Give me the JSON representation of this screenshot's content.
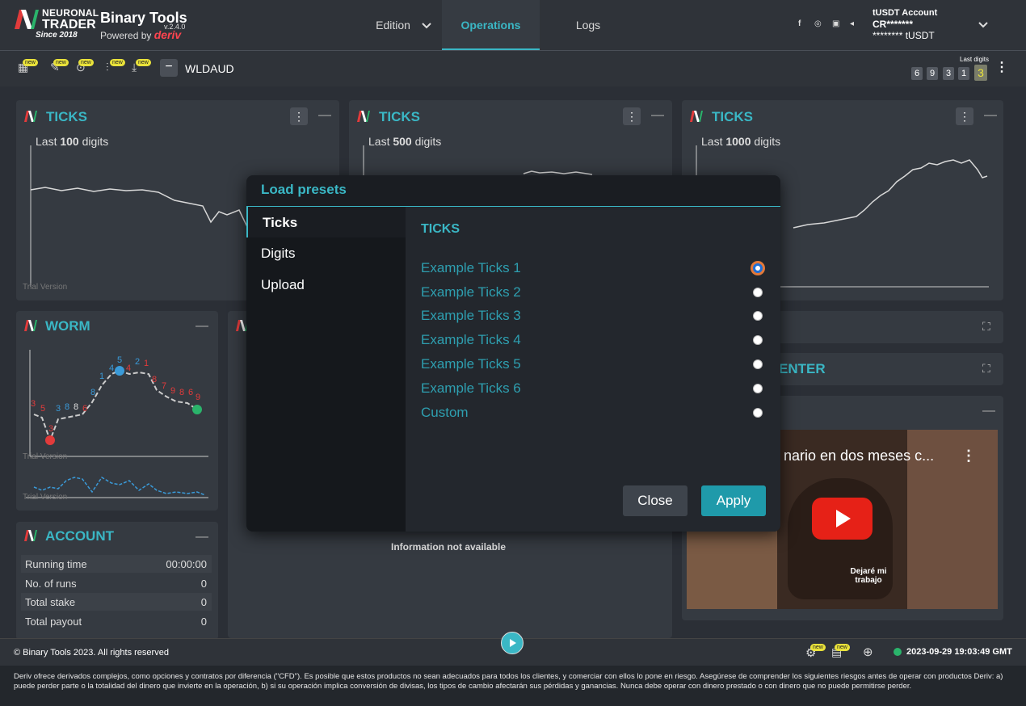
{
  "brand": {
    "line1": "NEURONAL",
    "line2": "TRADER",
    "since": "Since 2018",
    "title": "Binary Tools",
    "version": "v.2.4.0",
    "powered": "Powered by",
    "deriv": "deriv"
  },
  "nav": {
    "edition": "Edition",
    "operations": "Operations",
    "logs": "Logs"
  },
  "account": {
    "name": "tUSDT Account",
    "id": "CR*******",
    "balance": "******** tUSDT"
  },
  "toolbar": {
    "symbol": "WLDAUD",
    "new_badge": "new",
    "last_digits_label": "Last digits",
    "last_digits": [
      "6",
      "9",
      "3",
      "1",
      "3"
    ]
  },
  "panels": {
    "ticks1": {
      "title": "TICKS",
      "label_pre": "Last",
      "count": "100",
      "label_post": "digits"
    },
    "ticks2": {
      "title": "TICKS",
      "label_pre": "Last",
      "count": "500",
      "label_post": "digits"
    },
    "ticks3": {
      "title": "TICKS",
      "label_pre": "Last",
      "count": "1000",
      "label_post": "digits"
    },
    "worm": {
      "title": "WORM",
      "digits_top": [
        "3",
        "5",
        "3",
        "3",
        "8",
        "8",
        "6",
        "8",
        "1",
        "4",
        "5",
        "4",
        "2",
        "1",
        "8",
        "7",
        "9",
        "8",
        "6",
        "9"
      ],
      "digits_bottom": [
        "3",
        "5",
        "3",
        "3",
        "8",
        "8",
        "6",
        "8",
        "1",
        "4",
        "5",
        "4",
        "2",
        "1",
        "8",
        "7",
        "9",
        "8",
        "6",
        "9"
      ]
    },
    "account": {
      "title": "ACCOUNT",
      "rows": [
        {
          "k": "Running time",
          "v": "00:00:00"
        },
        {
          "k": "No. of runs",
          "v": "0"
        },
        {
          "k": "Total stake",
          "v": "0"
        },
        {
          "k": "Total payout",
          "v": "0"
        }
      ]
    },
    "center": {
      "title_fragment": "ENTER",
      "info": "Information not available"
    },
    "video": {
      "title": "nario en dos meses c...",
      "caption1": "Dejaré mi",
      "caption2": "trabajo"
    },
    "trial": "Trial Version"
  },
  "modal": {
    "title": "Load presets",
    "tabs": [
      "Ticks",
      "Digits",
      "Upload"
    ],
    "section": "TICKS",
    "options": [
      "Example Ticks 1",
      "Example Ticks 2",
      "Example Ticks 3",
      "Example Ticks 4",
      "Example Ticks 5",
      "Example Ticks 6",
      "Custom"
    ],
    "selected": 0,
    "close": "Close",
    "apply": "Apply"
  },
  "footer": {
    "copyright": "© Binary Tools 2023. All rights reserved",
    "datetime": "2023-09-29 19:03:49 GMT",
    "new_badge": "new"
  },
  "disclaimer": "Deriv ofrece derivados complejos, como opciones y contratos por diferencia (\"CFD\"). Es posible que estos productos no sean adecuados para todos los clientes, y comerciar con ellos lo pone en riesgo. Asegúrese de comprender los siguientes riesgos antes de operar con productos Deriv: a) puede perder parte o la totalidad del dinero que invierte en la operación, b) si su operación implica conversión de divisas, los tipos de cambio afectarán sus pérdidas y ganancias. Nunca debe operar con dinero prestado o con dinero que no puede permitirse perder."
}
